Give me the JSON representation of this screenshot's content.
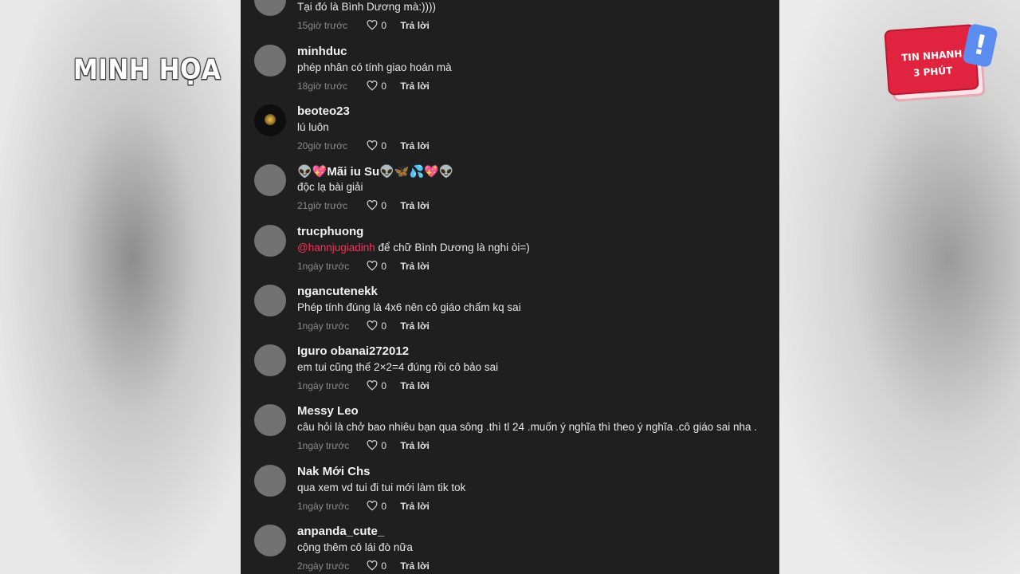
{
  "overlay": {
    "watermark": "MINH HỌA",
    "badge_line1": "TIN NHANH",
    "badge_line2": "3 PHÚT",
    "badge_mark": "!"
  },
  "ui": {
    "reply_label": "Trả lời",
    "heart_icon": "heart-outline-icon"
  },
  "comments": [
    {
      "username": "",
      "text": "Tại đó là Bình Dương mà:))))",
      "time": "15giờ trước",
      "likes": "0",
      "avatar": "gray"
    },
    {
      "username": "minhduc",
      "text": "phép nhân có tính giao hoán mà",
      "time": "18giờ trước",
      "likes": "0",
      "avatar": "gray"
    },
    {
      "username": "beoteo23",
      "text": "lú luôn",
      "time": "20giờ trước",
      "likes": "0",
      "avatar": "dark"
    },
    {
      "username": "👽💖Mãi iu Su👽🦋💦💖👽",
      "text": "độc lạ bài giải",
      "time": "21giờ trước",
      "likes": "0",
      "avatar": "gray"
    },
    {
      "username": "trucphuong",
      "mention": "@hannjugiadinh",
      "text": " để chữ Bình Dương là nghi òi=)",
      "time": "1ngày trước",
      "likes": "0",
      "avatar": "gray"
    },
    {
      "username": "ngancutenekk",
      "text": "Phép tính đúng là 4x6 nên cô giáo chấm kq sai",
      "time": "1ngày trước",
      "likes": "0",
      "avatar": "gray"
    },
    {
      "username": "Iguro obanai272012",
      "text": "em tui cũng thế 2×2=4 đúng rồi cô bảo sai",
      "time": "1ngày trước",
      "likes": "0",
      "avatar": "gray"
    },
    {
      "username": "Messy Leo",
      "text": "câu hỏi là chở bao nhiêu bạn qua sông .thì tl 24 .muốn ý nghĩa thì theo ý nghĩa .cô giáo sai nha .",
      "time": "1ngày trước",
      "likes": "0",
      "avatar": "gray"
    },
    {
      "username": "Nak Mới Chs",
      "text": "qua xem vd tui đi tui mới làm tik tok",
      "time": "1ngày trước",
      "likes": "0",
      "avatar": "gray"
    },
    {
      "username": "anpanda_cute_",
      "text": "cộng thêm cô lái đò nữa",
      "time": "2ngày trước",
      "likes": "0",
      "avatar": "gray"
    }
  ]
}
